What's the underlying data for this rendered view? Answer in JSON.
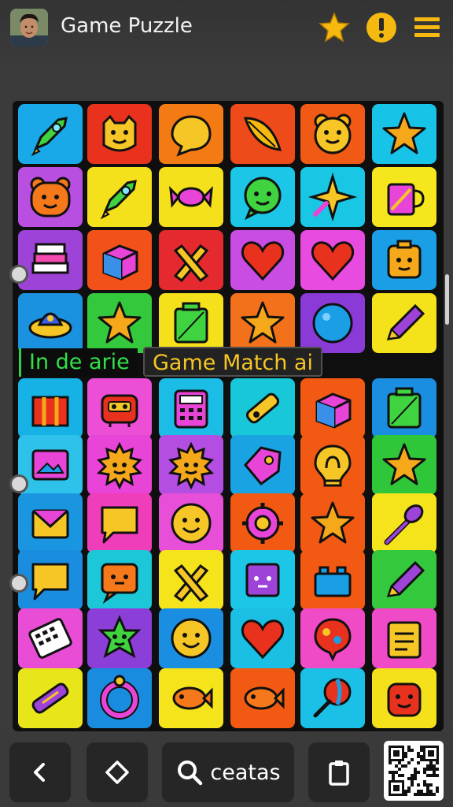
{
  "header": {
    "title": "Game Puzzle",
    "accent": "#f5b90f"
  },
  "board": {
    "rows": [
      [
        {
          "color": "#19a9e8",
          "icon": "rocket-icon"
        },
        {
          "color": "#e8321e",
          "icon": "smiley-cat-icon"
        },
        {
          "color": "#f47a13",
          "icon": "speech-bubble-icon"
        },
        {
          "color": "#ef4a1a",
          "icon": "leaf-icon"
        },
        {
          "color": "#f05a14",
          "icon": "smiley-bear-icon"
        },
        {
          "color": "#18c3e8",
          "icon": "star-icon"
        }
      ],
      [
        {
          "color": "#b84fe0",
          "icon": "bear-face-icon"
        },
        {
          "color": "#f5e11b",
          "icon": "rocket-icon"
        },
        {
          "color": "#f5e11b",
          "icon": "candy-icon"
        },
        {
          "color": "#1bc6e6",
          "icon": "smiley-chat-icon"
        },
        {
          "color": "#19c7e4",
          "icon": "sparkle-icon"
        },
        {
          "color": "#f5e61d",
          "icon": "mug-icon"
        }
      ],
      [
        {
          "color": "#9e43d8",
          "icon": "book-stack-icon"
        },
        {
          "color": "#f2521a",
          "icon": "cube-icon"
        },
        {
          "color": "#e42a2e",
          "icon": "crossed-pencils-icon"
        },
        {
          "color": "#c94de3",
          "icon": "heart-icon"
        },
        {
          "color": "#e74be0",
          "icon": "heart-icon"
        },
        {
          "color": "#1a9ee6",
          "icon": "block-face-icon"
        }
      ],
      [
        {
          "color": "#1a92e0",
          "icon": "ufo-icon"
        },
        {
          "color": "#34c93c",
          "icon": "star-icon"
        },
        {
          "color": "#f5e11b",
          "icon": "battery-icon"
        },
        {
          "color": "#f2711a",
          "icon": "star-icon"
        },
        {
          "color": "#8a3ad6",
          "icon": "ball-icon"
        },
        {
          "color": "#f4e21a",
          "icon": "pencil-icon"
        }
      ],
      [
        {
          "color": "#16b2e6",
          "icon": "gift-icon"
        },
        {
          "color": "#ec4fd6",
          "icon": "robot-icon"
        },
        {
          "color": "#1bbde6",
          "icon": "calculator-icon"
        },
        {
          "color": "#18c7d8",
          "icon": "usb-icon"
        },
        {
          "color": "#f25a14",
          "icon": "cube-icon"
        },
        {
          "color": "#1a8ee0",
          "icon": "battery-icon"
        }
      ],
      [
        {
          "color": "#2ec2ea",
          "icon": "picture-icon"
        },
        {
          "color": "#e845d8",
          "icon": "sun-face-icon"
        },
        {
          "color": "#b44ee3",
          "icon": "sun-face-icon"
        },
        {
          "color": "#1aa3e2",
          "icon": "tag-icon"
        },
        {
          "color": "#f25a14",
          "icon": "lightbulb-icon"
        },
        {
          "color": "#2fc63a",
          "icon": "star-icon"
        }
      ],
      [
        {
          "color": "#1a95df",
          "icon": "envelope-icon"
        },
        {
          "color": "#f03dba",
          "icon": "chat-bubble-icon"
        },
        {
          "color": "#e84fd8",
          "icon": "smiley-face-icon"
        },
        {
          "color": "#f25a14",
          "icon": "gear-face-icon"
        },
        {
          "color": "#f25a14",
          "icon": "star-icon"
        },
        {
          "color": "#f5e41b",
          "icon": "magic-wand-icon"
        }
      ],
      [
        {
          "color": "#1a8ddf",
          "icon": "chat-bubble-icon"
        },
        {
          "color": "#1cc8d8",
          "icon": "chat-face-icon"
        },
        {
          "color": "#f5e31b",
          "icon": "crossed-pencils-icon"
        },
        {
          "color": "#1bc6e6",
          "icon": "die-icon"
        },
        {
          "color": "#f25a14",
          "icon": "lego-brick-icon"
        },
        {
          "color": "#34c93c",
          "icon": "pencil-icon"
        }
      ],
      [
        {
          "color": "#e94dd5",
          "icon": "keyboard-icon"
        },
        {
          "color": "#8c3fd8",
          "icon": "star-face-icon"
        },
        {
          "color": "#1a8ee0",
          "icon": "smiley-face-icon"
        },
        {
          "color": "#1bbfe4",
          "icon": "heart-icon"
        },
        {
          "color": "#f04bc6",
          "icon": "balloon-icon"
        },
        {
          "color": "#f04bc6",
          "icon": "clipboard-icon"
        }
      ],
      [
        {
          "color": "#e8e61b",
          "icon": "tube-icon"
        },
        {
          "color": "#1a8ce0",
          "icon": "ring-icon"
        },
        {
          "color": "#f5e31b",
          "icon": "fish-icon"
        },
        {
          "color": "#f25a14",
          "icon": "fish-icon"
        },
        {
          "color": "#1bc0e6",
          "icon": "lollipop-icon"
        },
        {
          "color": "#f5e11b",
          "icon": "face-icon"
        }
      ]
    ]
  },
  "banner": {
    "left_text": "In de arie",
    "right_text": "Game Match ai"
  },
  "bottom_bar": {
    "search_label": "ceatas"
  }
}
